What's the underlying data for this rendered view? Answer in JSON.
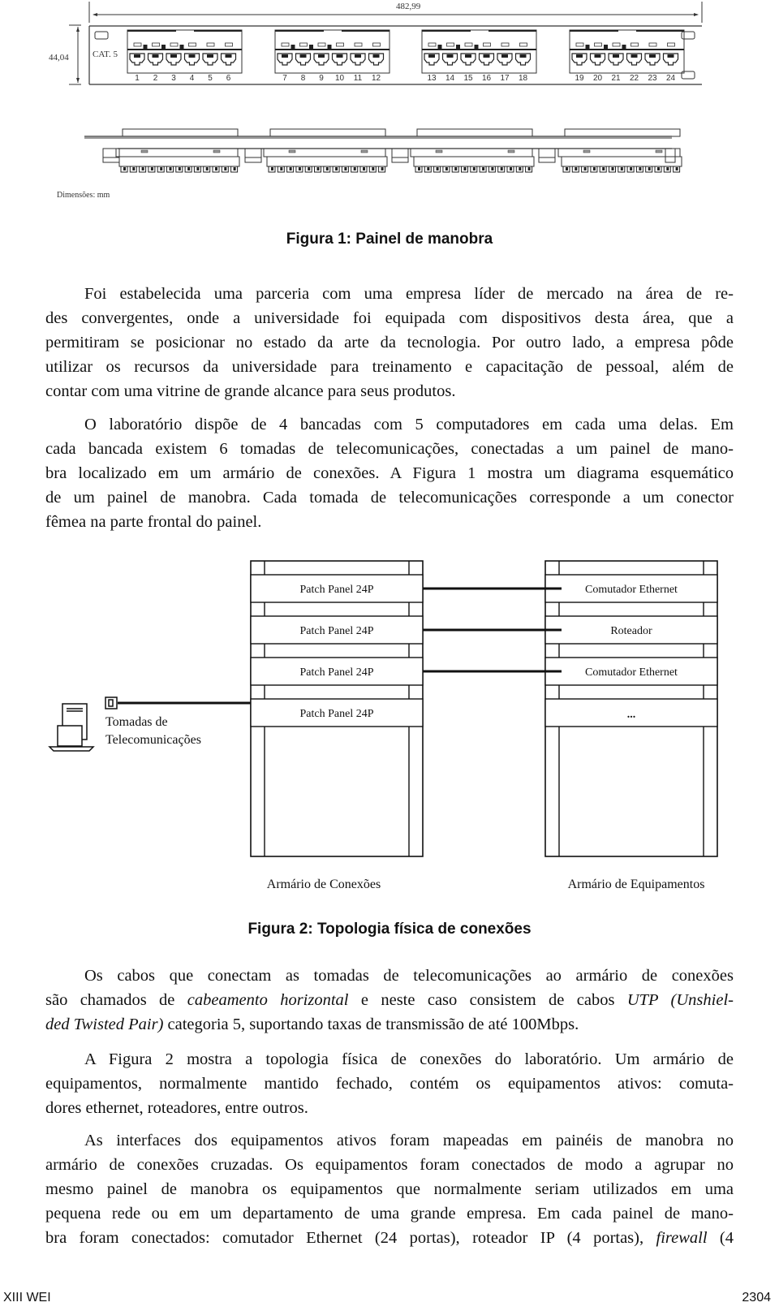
{
  "figure1": {
    "width_dim": "482,99",
    "height_dim": "44,04",
    "cat_label": "CAT. 5",
    "ports": [
      "1",
      "2",
      "3",
      "4",
      "5",
      "6",
      "7",
      "8",
      "9",
      "10",
      "11",
      "12",
      "13",
      "14",
      "15",
      "16",
      "17",
      "18",
      "19",
      "20",
      "21",
      "22",
      "23",
      "24"
    ],
    "units_note": "Dimensões: mm",
    "caption": "Figura 1: Painel de manobra"
  },
  "paragraphs": {
    "p1": [
      "Foi estabelecida uma parceria com uma empresa líder de mercado na área de re-",
      "des convergentes, onde a universidade foi equipada com dispositivos desta área, que a",
      "permitiram se posicionar no estado da arte da tecnologia. Por outro lado, a empresa pôde",
      "utilizar os recursos da universidade para treinamento e capacitação de pessoal, além de",
      "contar com uma vitrine de grande alcance para seus produtos."
    ],
    "p2": [
      "O laboratório dispõe de 4 bancadas com 5 computadores em cada uma delas. Em",
      "cada bancada existem 6 tomadas de telecomunicações, conectadas a um painel de mano-",
      "bra localizado em um armário de conexões. A Figura 1 mostra um diagrama esquemático",
      "de um painel de manobra. Cada tomada de telecomunicações corresponde a um conector",
      "fêmea na parte frontal do painel."
    ],
    "p3": {
      "l1": "Os cabos que conectam as tomadas de telecomunicações ao armário de conexões",
      "l2a": "são chamados de ",
      "l2b": "cabeamento horizontal",
      "l2c": " e neste caso consistem de cabos ",
      "l2d": "UTP (Unshiel-",
      "l3a": "ded Twisted Pair)",
      "l3b": " categoria 5, suportando taxas de transmissão de até 100Mbps."
    },
    "p4": [
      "A Figura 2 mostra a topologia física de conexões do laboratório. Um armário de",
      "equipamentos, normalmente mantido fechado, contém os equipamentos ativos: comuta-",
      "dores ethernet, roteadores, entre outros."
    ],
    "p5": {
      "l1": "As interfaces dos equipamentos ativos foram mapeadas em painéis de manobra no",
      "l2": "armário de conexões cruzadas. Os equipamentos foram conectados de modo a agrupar no",
      "l3": "mesmo painel de manobra os equipamentos que normalmente seriam utilizados em uma",
      "l4": "pequena rede ou em um departamento de uma grande empresa. Em cada painel de mano-",
      "l5a": "bra foram conectados: comutador Ethernet (24 portas), roteador IP (4 portas), ",
      "l5b": "firewall",
      "l5c": " (4"
    }
  },
  "figure2": {
    "outlet_label_1": "Tomadas de",
    "outlet_label_2": "Telecomunicações",
    "connections_cabinet": {
      "label": "Armário de Conexões",
      "slots": [
        "Patch Panel 24P",
        "Patch Panel 24P",
        "Patch Panel 24P",
        "Patch Panel 24P"
      ]
    },
    "equipment_cabinet": {
      "label": "Armário de Equipamentos",
      "slots": [
        "Comutador Ethernet",
        "Roteador",
        "Comutador Ethernet",
        "..."
      ]
    },
    "caption": "Figura 2: Topologia física de conexões"
  },
  "footer": {
    "left": "XIII WEI",
    "right": "2304"
  }
}
